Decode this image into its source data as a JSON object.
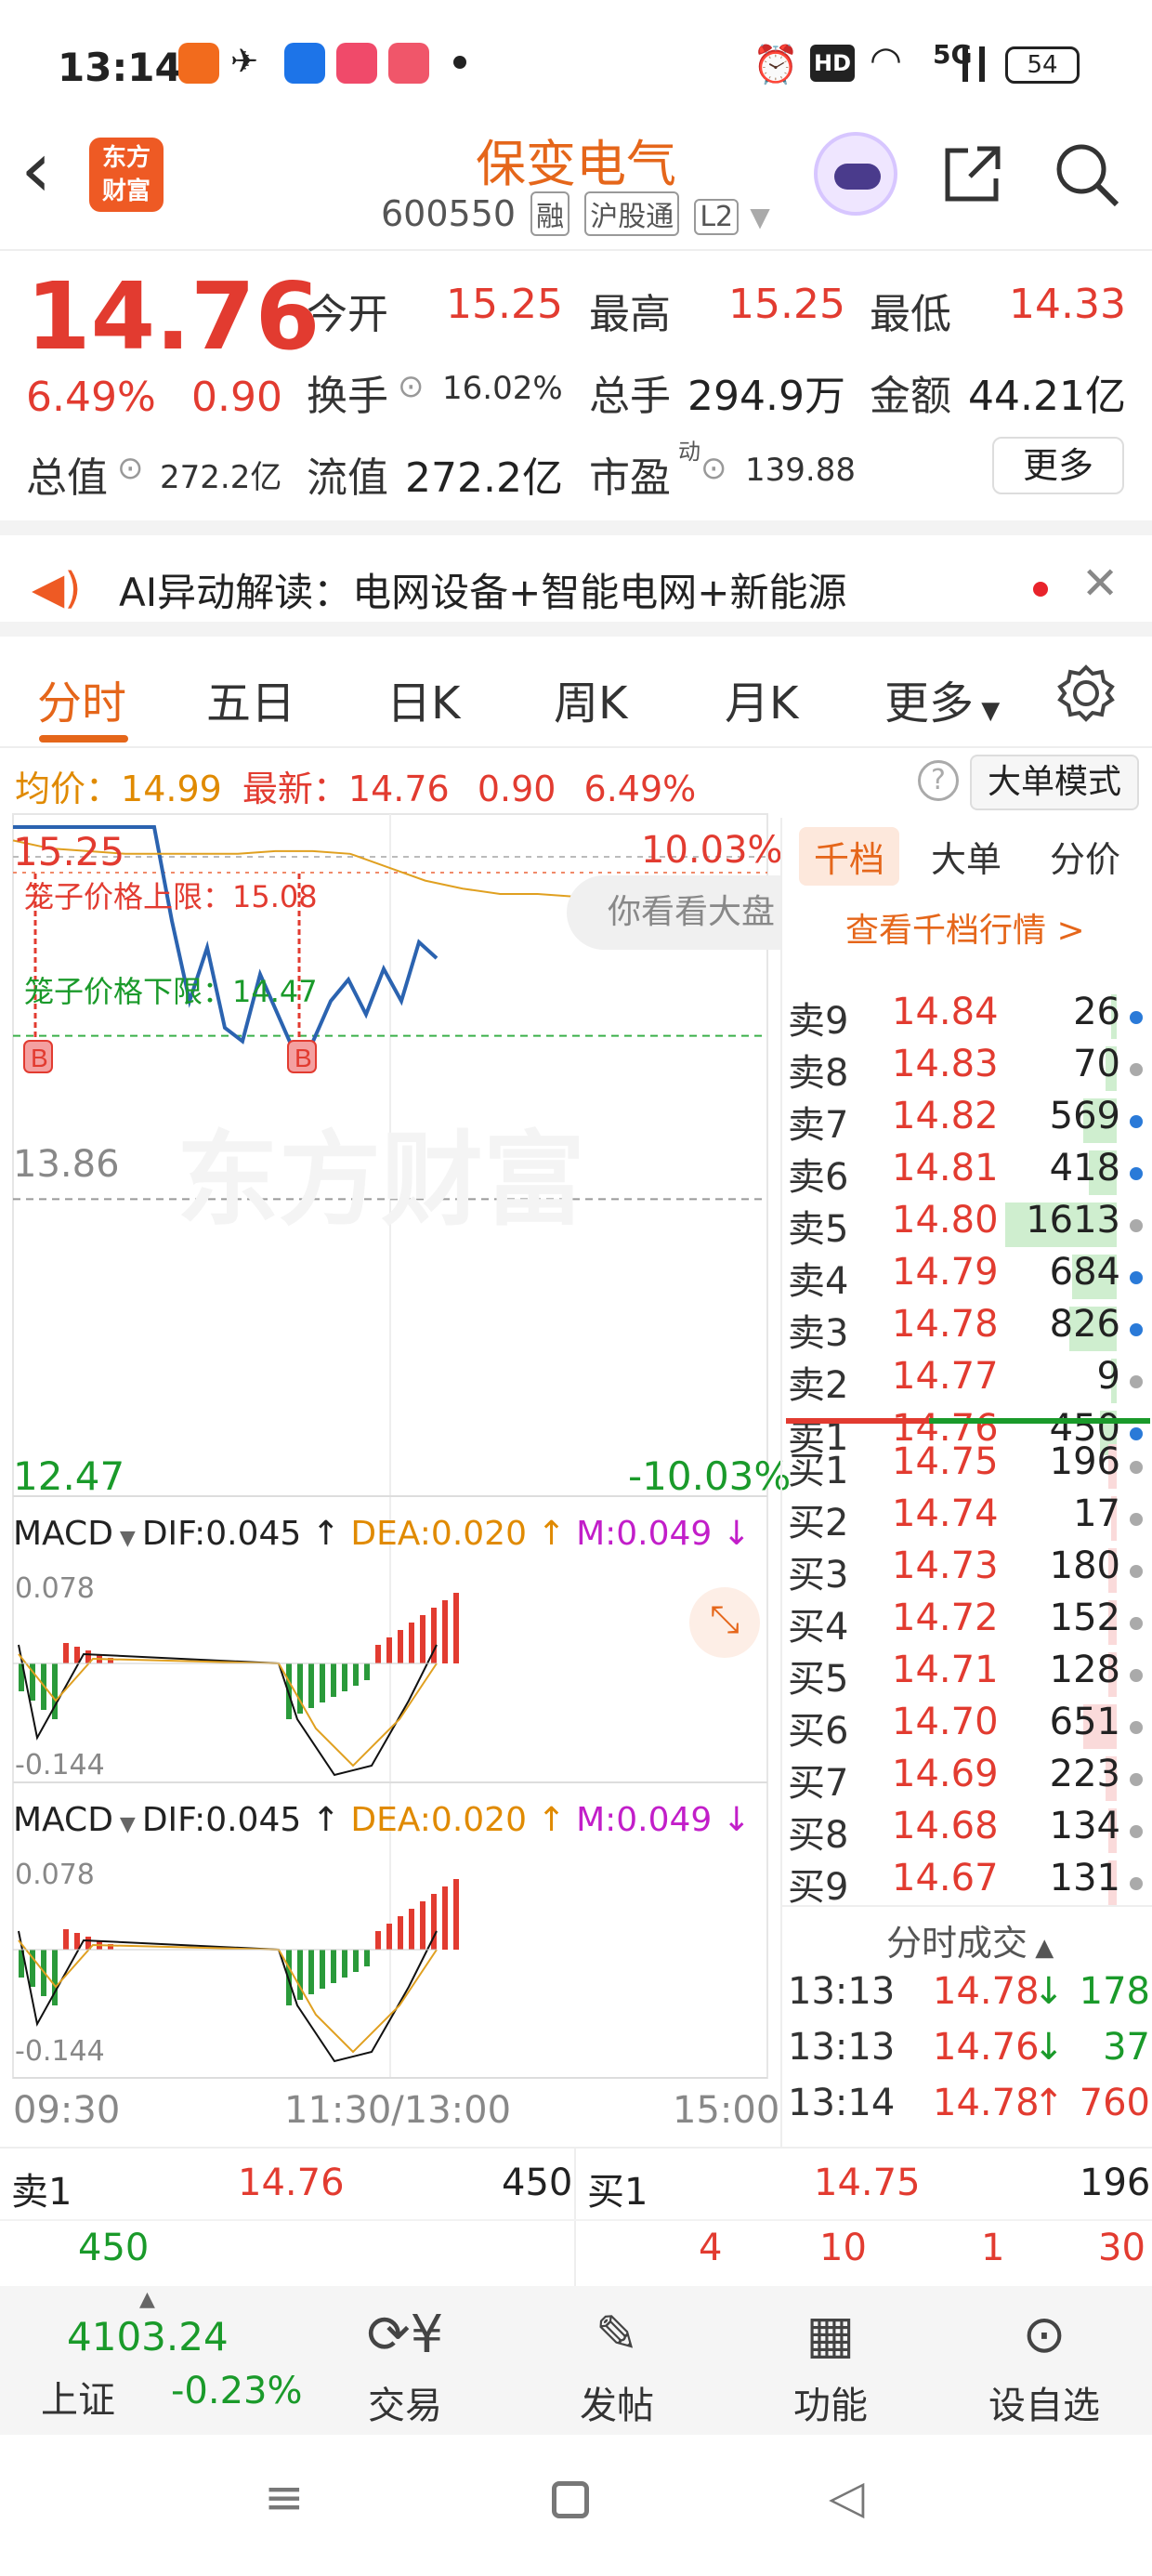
{
  "status": {
    "time": "13:14",
    "network": "5G",
    "battery": "54"
  },
  "header": {
    "logo_text_1": "东方",
    "logo_text_2": "财富",
    "title": "保变电气",
    "code": "600550",
    "tags": [
      "融",
      "沪股通",
      "L2"
    ]
  },
  "quote": {
    "price": "14.76",
    "change_pct": "6.49%",
    "change": "0.90",
    "open_label": "今开",
    "open": "15.25",
    "high_label": "最高",
    "high": "15.25",
    "low_label": "最低",
    "low": "14.33",
    "turnover_label": "换手",
    "turnover": "16.02%",
    "volume_label": "总手",
    "volume": "294.9万",
    "amount_label": "金额",
    "amount": "44.21亿",
    "mktcap_label": "总值",
    "mktcap": "272.2亿",
    "float_label": "流值",
    "float": "272.2亿",
    "pe_label": "市盈",
    "pe_sup": "动",
    "pe": "139.88",
    "more": "更多"
  },
  "ai": {
    "text": "AI异动解读：电网设备+智能电网+新能源"
  },
  "tabs": [
    "分时",
    "五日",
    "日K",
    "周K",
    "月K",
    "更多"
  ],
  "infoline": {
    "avg_label": "均价：",
    "avg": "14.99",
    "latest_label": "最新：",
    "latest": "14.76",
    "chg": "0.90",
    "pct": "6.49%",
    "mode": "大单模式"
  },
  "chart": {
    "top_price": "15.25",
    "top_pct": "10.03%",
    "upper_limit": "笼子价格上限：15.08",
    "lower_limit": "笼子价格下限：14.47",
    "mid_price": "13.86",
    "bottom_price": "12.47",
    "bottom_pct": "-10.03%",
    "watermark": "东方财富",
    "bubble": "你看看大盘",
    "macd_label": "MACD",
    "dif": "DIF:0.045",
    "dea": "DEA:0.020",
    "m": "M:0.049",
    "macd_max": "0.078",
    "macd_min": "-0.144",
    "times": [
      "09:30",
      "11:30/13:00",
      "15:00"
    ],
    "marker": "B"
  },
  "chart_data": {
    "type": "line",
    "title": "",
    "series": [],
    "price_points": [
      15.25,
      15.25,
      15.25,
      15.25,
      15.25,
      15.25,
      15.25,
      15.25,
      15.25,
      14.9,
      14.6,
      14.8,
      14.5,
      14.45,
      14.7,
      14.55,
      14.4,
      14.45,
      14.6,
      14.68,
      14.55,
      14.72,
      14.6,
      14.82,
      14.76
    ],
    "avg_points": [
      15.2,
      15.17,
      15.16,
      15.15,
      15.15,
      15.15,
      15.15,
      15.16,
      15.16,
      15.15,
      15.1,
      15.05,
      15.02,
      15.0,
      15.0,
      14.99,
      14.99,
      14.99,
      14.99
    ],
    "ylim": [
      12.47,
      15.25
    ],
    "ref_price": 13.86,
    "cage_upper": 15.08,
    "cage_lower": 14.47
  },
  "orderbook": {
    "tabs": [
      "千档",
      "大单",
      "分价"
    ],
    "link": "查看千档行情 >",
    "asks": [
      {
        "label": "卖9",
        "price": "14.84",
        "vol": "26",
        "fill": 0.02
      },
      {
        "label": "卖8",
        "price": "14.83",
        "vol": "70",
        "fill": 0.04
      },
      {
        "label": "卖7",
        "price": "14.82",
        "vol": "569",
        "fill": 0.12
      },
      {
        "label": "卖6",
        "price": "14.81",
        "vol": "418",
        "fill": 0.1
      },
      {
        "label": "卖5",
        "price": "14.80",
        "vol": "1613",
        "fill": 0.4
      },
      {
        "label": "卖4",
        "price": "14.79",
        "vol": "684",
        "fill": 0.16
      },
      {
        "label": "卖3",
        "price": "14.78",
        "vol": "826",
        "fill": 0.17
      },
      {
        "label": "卖2",
        "price": "14.77",
        "vol": "9",
        "fill": 0.01
      },
      {
        "label": "卖1",
        "price": "14.76",
        "vol": "450",
        "fill": 0.06
      }
    ],
    "bids": [
      {
        "label": "买1",
        "price": "14.75",
        "vol": "196",
        "fill": 0.03
      },
      {
        "label": "买2",
        "price": "14.74",
        "vol": "17",
        "fill": 0.01
      },
      {
        "label": "买3",
        "price": "14.73",
        "vol": "180",
        "fill": 0.03
      },
      {
        "label": "买4",
        "price": "14.72",
        "vol": "152",
        "fill": 0.03
      },
      {
        "label": "买5",
        "price": "14.71",
        "vol": "128",
        "fill": 0.03
      },
      {
        "label": "买6",
        "price": "14.70",
        "vol": "651",
        "fill": 0.12
      },
      {
        "label": "买7",
        "price": "14.69",
        "vol": "223",
        "fill": 0.04
      },
      {
        "label": "买8",
        "price": "14.68",
        "vol": "134",
        "fill": 0.03
      },
      {
        "label": "买9",
        "price": "14.67",
        "vol": "131",
        "fill": 0.03
      }
    ],
    "ticks_title": "分时成交",
    "ticks": [
      {
        "time": "13:13",
        "price": "14.78",
        "dir": "↓",
        "vol": "178"
      },
      {
        "time": "13:13",
        "price": "14.76",
        "dir": "↓",
        "vol": "37"
      },
      {
        "time": "13:14",
        "price": "14.78",
        "dir": "↑",
        "vol": "760"
      }
    ]
  },
  "bottom_quote": {
    "sell_label": "卖1",
    "sell_price": "14.76",
    "sell_vol": "450",
    "buy_label": "买1",
    "buy_price": "14.75",
    "buy_vol": "196",
    "left_vol": "450",
    "right_vals": [
      "4",
      "10",
      "1",
      "30"
    ]
  },
  "bottom_nav": {
    "index_value": "4103.24",
    "index_name": "上证",
    "index_pct": "-0.23%",
    "items": [
      "交易",
      "发帖",
      "功能",
      "设自选"
    ]
  }
}
